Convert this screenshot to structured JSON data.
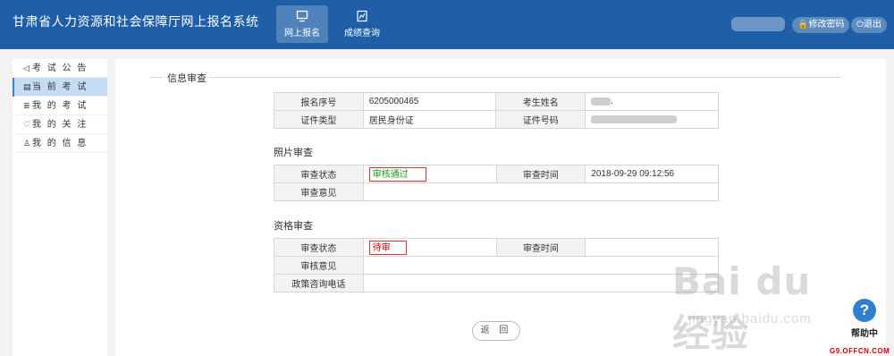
{
  "app": {
    "title": "甘肃省人力资源和社会保障厅网上报名系统"
  },
  "header": {
    "nav": [
      {
        "label": "网上报名",
        "icon": "monitor-icon",
        "active": true
      },
      {
        "label": "成绩查询",
        "icon": "document-chart-icon",
        "active": false
      }
    ],
    "change_password": "修改密码",
    "logout": "退出"
  },
  "sidebar": {
    "items": [
      {
        "label": "考 试 公 告",
        "icon": "speaker-icon"
      },
      {
        "label": "当 前 考 试",
        "icon": "doc-icon",
        "active": true
      },
      {
        "label": "我 的 考 试",
        "icon": "list-icon"
      },
      {
        "label": "我 的 关 注",
        "icon": "heart-icon"
      },
      {
        "label": "我 的 信 息",
        "icon": "user-icon"
      }
    ]
  },
  "main": {
    "legend": "信息审查",
    "basic": {
      "reg_no_label": "报名序号",
      "reg_no_value": "6205000465",
      "name_label": "考生姓名",
      "name_value_suffix": ".",
      "id_type_label": "证件类型",
      "id_type_value": "居民身份证",
      "id_no_label": "证件号码"
    },
    "photo_review": {
      "title": "照片审查",
      "status_label": "审查状态",
      "status_value": "审核通过",
      "time_label": "审查时间",
      "time_value": "2018-09-29 09:12:56",
      "opinion_label": "审查意见"
    },
    "qual_review": {
      "title": "资格审查",
      "status_label": "审查状态",
      "status_value": "待审",
      "time_label": "审查时间",
      "opinion_label": "审核意见",
      "phone_label": "政策咨询电话"
    },
    "back_label": "返 回"
  },
  "watermark": {
    "big": "Bai du 经验",
    "small": "jingyan.baidu.com"
  },
  "help": {
    "icon_text": "?",
    "label": "帮助中"
  },
  "offcn": "G9.OFFCN.COM"
}
